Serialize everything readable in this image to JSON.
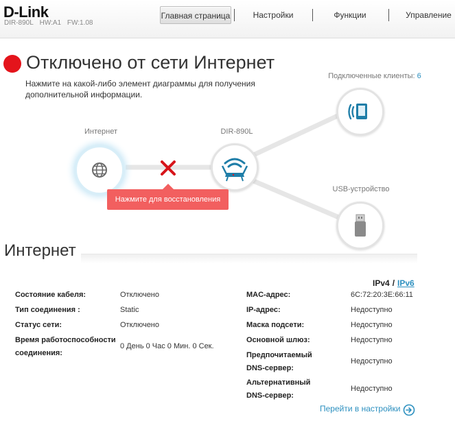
{
  "header": {
    "logo": "D-Link",
    "model": "DIR-890L",
    "hw": "HW:A1",
    "fw": "FW:1.08",
    "nav": [
      "Главная страница",
      "Настройки",
      "Функции",
      "Управление"
    ]
  },
  "status": {
    "title": "Отключено от сети Интернет",
    "hint": "Нажмите на какой-либо элемент диаграммы для получения дополнительной информации.",
    "color": "#e4141b"
  },
  "diagram": {
    "internet_label": "Интернет",
    "router_label": "DIR-890L",
    "clients_label": "Подключенные клиенты:",
    "clients_count": "6",
    "usb_label": "USB-устройство",
    "tooltip": "Нажмите для восстановления",
    "icons": [
      "globe-icon",
      "router-icon",
      "wireless-device-icon",
      "usb-drive-icon",
      "disconnected-x-icon"
    ]
  },
  "internet": {
    "title": "Интернет",
    "ipv4": "IPv4",
    "ipv6": "IPv6",
    "left": [
      {
        "label": "Состояние кабеля:",
        "value": "Отключено"
      },
      {
        "label": "Тип соединения :",
        "value": "Static"
      },
      {
        "label": "Статус сети:",
        "value": "Отключено"
      },
      {
        "label1": "Время работоспособности",
        "label2": "соединения:",
        "value": "0 День 0 Час 0 Мин. 0 Сек."
      }
    ],
    "right": [
      {
        "label": "MAC-адрес:",
        "value": "6C:72:20:3E:66:11"
      },
      {
        "label": "IP-адрес:",
        "value": "Недоступно"
      },
      {
        "label": "Маска подсети:",
        "value": "Недоступно"
      },
      {
        "label": "Основной шлюз:",
        "value": "Недоступно"
      },
      {
        "label1": "Предпочитаемый",
        "label2": "DNS-сервер:",
        "value": "Недоступно"
      },
      {
        "label1": "Альтернативный",
        "label2": "DNS-сервер:",
        "value": "Недоступно"
      }
    ],
    "goto_settings": "Перейти в настройки"
  },
  "colors": {
    "accent": "#2b8fbf",
    "icon_teal": "#1f7ea8",
    "error_red": "#e4141b",
    "tooltip_red": "#f25f5f"
  }
}
